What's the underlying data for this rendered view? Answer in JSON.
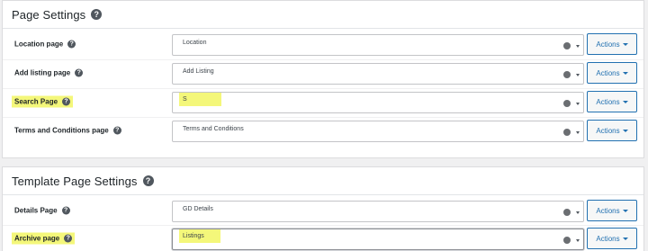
{
  "sections": [
    {
      "title": "Page Settings",
      "rows": [
        {
          "label": "Location page",
          "value": "Location",
          "actions": "Actions"
        },
        {
          "label": "Add listing page",
          "value": "Add Listing",
          "actions": "Actions"
        },
        {
          "label": "Search Page",
          "value": "S",
          "actions": "Actions"
        },
        {
          "label": "Terms and Conditions page",
          "value": "Terms and Conditions",
          "actions": "Actions"
        }
      ]
    },
    {
      "title": "Template Page Settings",
      "rows": [
        {
          "label": "Details Page",
          "value": "GD Details",
          "actions": "Actions"
        },
        {
          "label": "Archive page",
          "value": "Listings",
          "actions": "Actions"
        }
      ]
    }
  ],
  "help_glyph": "?",
  "colors": {
    "accent": "#2271b1",
    "highlight": "#f4f77a",
    "help_icon": "#50575e"
  }
}
